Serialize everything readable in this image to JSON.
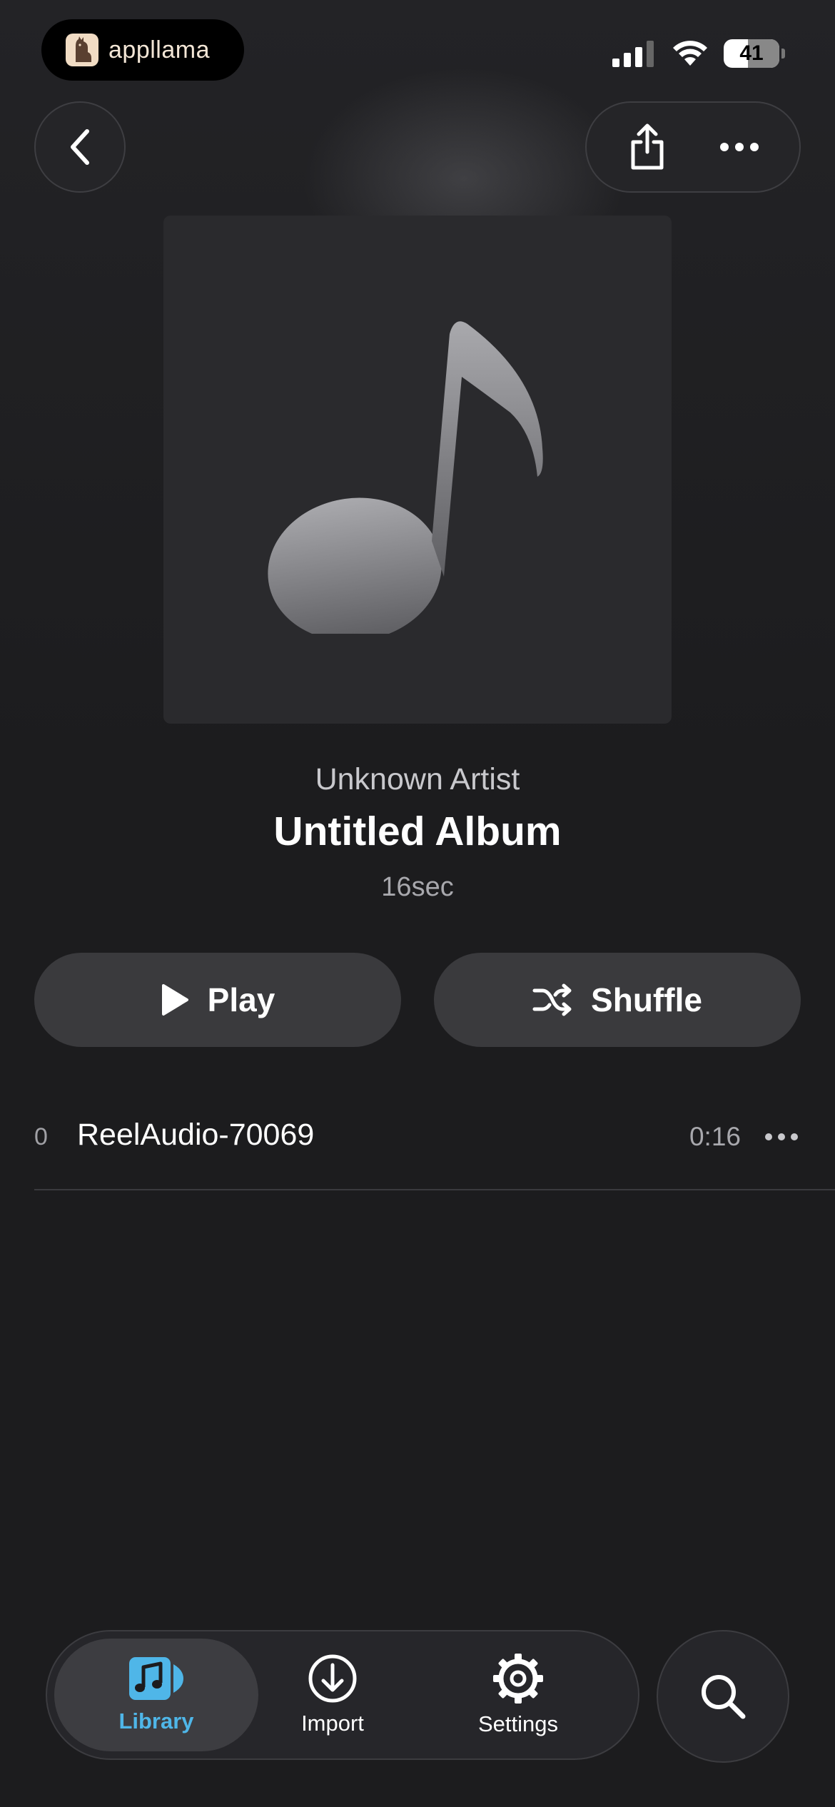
{
  "status_bar": {
    "app_badge_label": "appllama",
    "battery_level": "41"
  },
  "header": {
    "back_icon": "chevron-left-icon",
    "share_icon": "share-icon",
    "more_icon": "ellipsis-icon"
  },
  "album": {
    "artwork_icon": "music-note-icon",
    "artist": "Unknown Artist",
    "title": "Untitled Album",
    "duration": "16sec"
  },
  "actions": {
    "play_label": "Play",
    "shuffle_label": "Shuffle"
  },
  "tracks": [
    {
      "number": "0",
      "title": "ReelAudio-70069",
      "duration": "0:16"
    }
  ],
  "tab_bar": {
    "items": [
      {
        "label": "Library",
        "icon": "music-library-icon",
        "active": true
      },
      {
        "label": "Import",
        "icon": "download-icon",
        "active": false
      },
      {
        "label": "Settings",
        "icon": "gear-icon",
        "active": false
      }
    ],
    "search_icon": "search-icon"
  },
  "colors": {
    "background": "#1c1c1e",
    "accent": "#4fb6e8",
    "button": "#3a3a3d"
  }
}
